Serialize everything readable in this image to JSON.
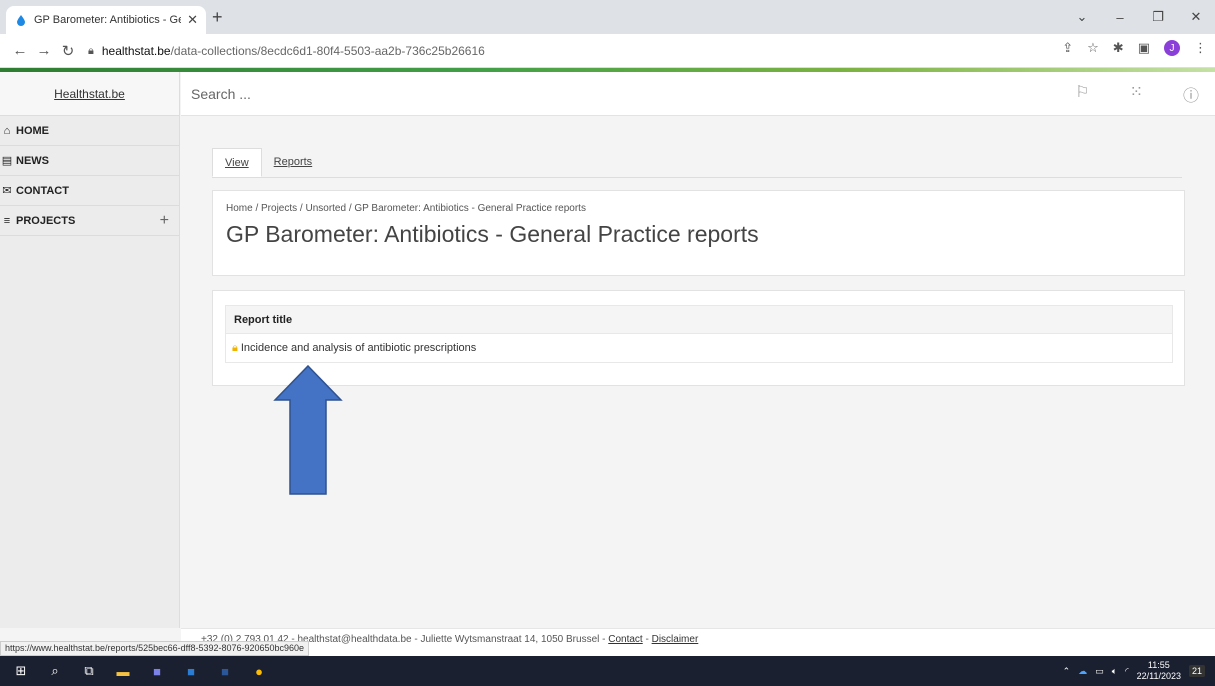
{
  "browser": {
    "tab_title": "GP Barometer: Antibiotics - Gen",
    "new_tab": "+",
    "url_domain": "healthstat.be",
    "url_path": "/data-collections/8ecdc6d1-80f4-5503-aa2b-736c25b26616",
    "profile_initial": "J",
    "status_url": "https://www.healthstat.be/reports/525bec66-dff8-5392-8076-920650bc960e"
  },
  "sidebar": {
    "brand": "Healthstat.be",
    "items": [
      {
        "label": "HOME",
        "icon": "home-icon"
      },
      {
        "label": "NEWS",
        "icon": "news-icon"
      },
      {
        "label": "CONTACT",
        "icon": "envelope-icon"
      },
      {
        "label": "PROJECTS",
        "icon": "database-icon"
      }
    ]
  },
  "topbar": {
    "search_placeholder": "Search ..."
  },
  "page_tabs": [
    {
      "label": "View"
    },
    {
      "label": "Reports"
    }
  ],
  "breadcrumb": "Home / Projects / Unsorted / GP Barometer: Antibiotics - General Practice reports",
  "page_title": "GP Barometer: Antibiotics - General Practice reports",
  "reports_table": {
    "header": "Report title",
    "rows": [
      {
        "title": "Incidence and analysis of antibiotic prescriptions"
      }
    ]
  },
  "footer": {
    "text": "+32 (0) 2 793 01 42 - healthstat@healthdata.be - Juliette Wytsmanstraat 14, 1050 Brussel - ",
    "contact": "Contact",
    "separator": " - ",
    "disclaimer": "Disclaimer"
  },
  "taskbar": {
    "time": "11:55",
    "date": "22/11/2023",
    "notifications": "21"
  },
  "colors": {
    "arrow": "#4472c4",
    "accent_green": "#43a047",
    "lock": "#f0b400"
  }
}
